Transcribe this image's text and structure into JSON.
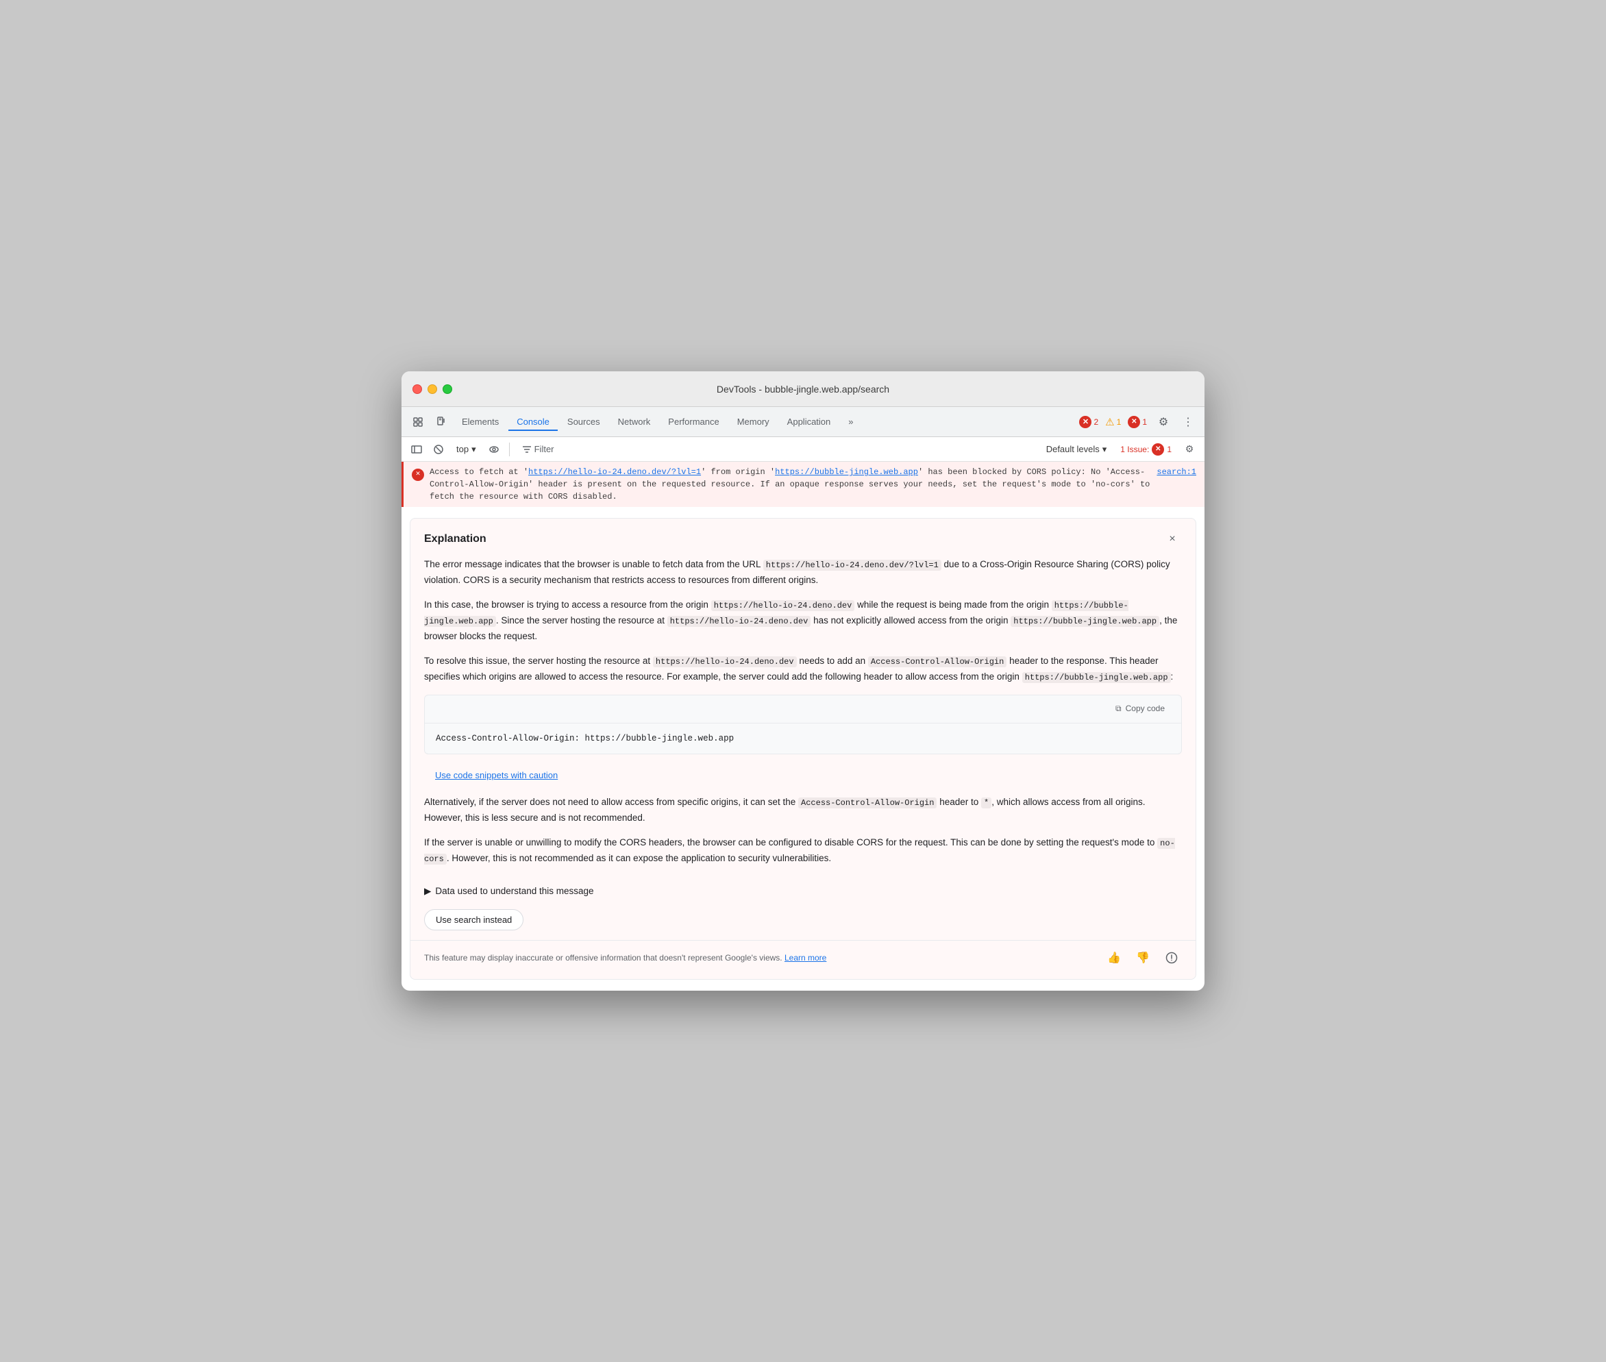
{
  "window": {
    "title": "DevTools - bubble-jingle.web.app/search"
  },
  "tabs": {
    "items": [
      {
        "label": "Elements",
        "active": false
      },
      {
        "label": "Console",
        "active": true
      },
      {
        "label": "Sources",
        "active": false
      },
      {
        "label": "Network",
        "active": false
      },
      {
        "label": "Performance",
        "active": false
      },
      {
        "label": "Memory",
        "active": false
      },
      {
        "label": "Application",
        "active": false
      },
      {
        "label": "»",
        "active": false
      }
    ],
    "error_count": "2",
    "warn_count": "1",
    "info_count": "1"
  },
  "toolbar": {
    "context": "top",
    "filter_label": "Filter",
    "levels_label": "Default levels",
    "issue_label": "1 Issue:",
    "issue_count": "1"
  },
  "error": {
    "message_start": "Access to fetch at '",
    "url1": "https://hello-io-24.deno.dev/?lvl=1",
    "message_mid": "' from origin '",
    "url2": "https://bubble-jingle.web.app",
    "message_end": "' has been blocked by CORS policy: No 'Access-Control-Allow-Origin' header is present on the requested resource. If an opaque response serves your needs, set the request's mode to 'no-cors' to fetch the resource with CORS disabled.",
    "source": "search:1"
  },
  "explanation": {
    "title": "Explanation",
    "body_p1": "The error message indicates that the browser is unable to fetch data from the URL ",
    "body_p1_code": "https://hello-io-24.deno.dev/?lvl=1",
    "body_p1_end": " due to a Cross-Origin Resource Sharing (CORS) policy violation. CORS is a security mechanism that restricts access to resources from different origins.",
    "body_p2_start": "In this case, the browser is trying to access a resource from the origin ",
    "body_p2_code1": "https://hello-io-24.deno.dev",
    "body_p2_mid": " while the request is being made from the origin ",
    "body_p2_code2": "https://bubble-jingle.web.app",
    "body_p2_mid2": ". Since the server hosting the resource at ",
    "body_p2_code3": "https://hello-io-24.deno.dev",
    "body_p2_end": " has not explicitly allowed access from the origin ",
    "body_p2_code4": "https://bubble-jingle.web.app",
    "body_p2_end2": ", the browser blocks the request.",
    "body_p3_start": "To resolve this issue, the server hosting the resource at ",
    "body_p3_code1": "https://hello-io-24.deno.dev",
    "body_p3_mid": " needs to add an ",
    "body_p3_code2": "Access-Control-Allow-Origin",
    "body_p3_end": " header to the response. This header specifies which origins are allowed to access the resource. For example, the server could add the following header to allow access from the origin ",
    "body_p3_code3": "https://bubble-jingle.web.app",
    "body_p3_end2": ":",
    "code_block": "Access-Control-Allow-Origin: https://bubble-jingle.web.app",
    "copy_label": "Copy code",
    "caution_link": "Use code snippets with caution",
    "body_p4_start": "Alternatively, if the server does not need to allow access from specific origins, it can set the ",
    "body_p4_code": "Access-Control-Allow-Origin",
    "body_p4_mid": " header to ",
    "body_p4_star": "*",
    "body_p4_end": ", which allows access from all origins. However, this is less secure and is not recommended.",
    "body_p5_start": "If the server is unable or unwilling to modify the CORS headers, the browser can be configured to disable CORS for the request. This can be done by setting the request's mode to ",
    "body_p5_code": "no-cors",
    "body_p5_end": ". However, this is not recommended as it can expose the application to security vulnerabilities.",
    "data_used_label": "Data used to understand this message",
    "search_instead": "Use search instead",
    "disclaimer": "This feature may display inaccurate or offensive information that doesn't represent Google's views.",
    "learn_more": "Learn more"
  },
  "icons": {
    "close": "×",
    "chevron_right": "▶",
    "thumbs_up": "👍",
    "thumbs_down": "👎",
    "info_circle": "ℹ",
    "copy": "⧉",
    "more": "⋮",
    "filter": "⊟",
    "inspect": "⬚",
    "no_entry": "⊘",
    "eye": "◉",
    "gear": "⚙",
    "chevron_down": "▾"
  }
}
